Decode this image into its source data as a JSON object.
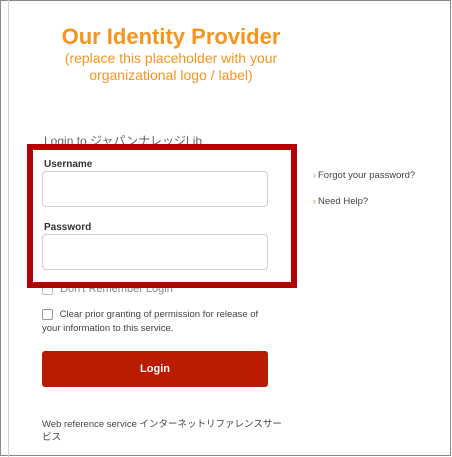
{
  "logo": {
    "title": "Our Identity Provider",
    "subtitle_line1": "(replace this placeholder with your",
    "subtitle_line2": "organizational logo / label)"
  },
  "login_to": "Login to ジャパンナレッジLib",
  "username": {
    "label": "Username",
    "value": ""
  },
  "password": {
    "label": "Password",
    "value": ""
  },
  "dont_remember": {
    "label": "Don't Remember Login"
  },
  "consent": {
    "label": "Clear prior granting of permission for release of your information to this service."
  },
  "login_button": "Login",
  "footer": "Web reference service インターネットリファレンスサービス",
  "links": {
    "forgot_password": "Forgot your password?",
    "need_help": "Need Help?",
    "caret": "›"
  },
  "colors": {
    "accent": "#f7941d",
    "button": "#b91c00",
    "highlight": "#b30000"
  }
}
